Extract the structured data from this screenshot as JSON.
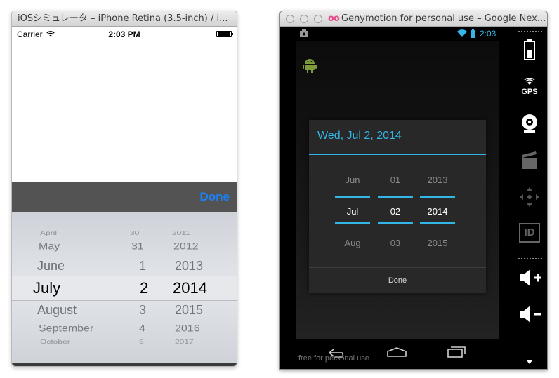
{
  "ios": {
    "window_title": "iOSシミュレータ – iPhone Retina (3.5-inch) / i...",
    "carrier": "Carrier",
    "time": "2:03 PM",
    "done_label": "Done",
    "picker": {
      "months": [
        "April",
        "May",
        "June",
        "July",
        "August",
        "September",
        "October"
      ],
      "days": [
        "30",
        "31",
        "1",
        "2",
        "3",
        "4",
        "5"
      ],
      "years": [
        "2011",
        "2012",
        "2013",
        "2014",
        "2015",
        "2016",
        "2017"
      ],
      "selected": {
        "month": "July",
        "day": "2",
        "year": "2014"
      }
    }
  },
  "genymotion": {
    "window_title": "Genymotion for personal use – Google Nex...",
    "status_time": "2:03",
    "watermark": "free for personal use",
    "sidebar": {
      "gps_label": "GPS",
      "id_label": "ID"
    },
    "accent_color": "#33b5e5",
    "dialog": {
      "title": "Wed, Jul 2, 2014",
      "month": {
        "prev": "Jun",
        "current": "Jul",
        "next": "Aug"
      },
      "day": {
        "prev": "01",
        "current": "02",
        "next": "03"
      },
      "year": {
        "prev": "2013",
        "current": "2014",
        "next": "2015"
      },
      "done_label": "Done"
    }
  }
}
